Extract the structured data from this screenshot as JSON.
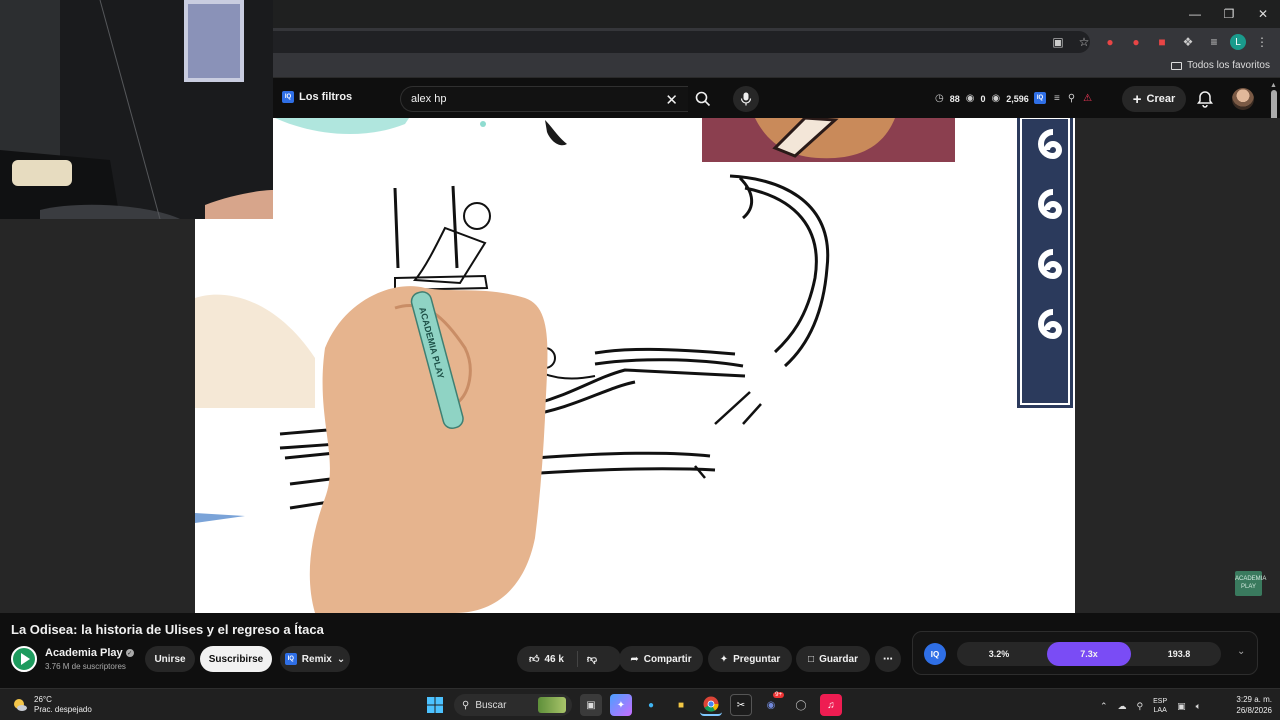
{
  "browser": {
    "bookmarks_folder": "Todos los favoritos",
    "profile_initial": "L"
  },
  "header": {
    "filters_label": "Los filtros",
    "iq_label": "IQ",
    "search_value": "alex hp",
    "stats": {
      "time": "88",
      "views_zero": "0",
      "views": "2,596"
    },
    "create_label": "Crear"
  },
  "video": {
    "title": "La Odisea: la historia de Ulises y el regreso a Ítaca",
    "watermark": "ACADEMIA PLAY",
    "pen_text": "ACADEMIA PLAY"
  },
  "channel": {
    "name": "Academia Play",
    "subscribers": "3.76 M de suscriptores",
    "join_label": "Unirse",
    "subscribe_label": "Suscribirse",
    "remix_label": "Remix"
  },
  "actions": {
    "likes": "46 k",
    "share_label": "Compartir",
    "ask_label": "Preguntar",
    "save_label": "Guardar"
  },
  "speed": {
    "values": [
      "3.2%",
      "7.3x",
      "193.8"
    ],
    "active_index": 1
  },
  "taskbar": {
    "temperature": "26°C",
    "weather_desc": "Prac. despejado",
    "search_label": "Buscar",
    "lang_top": "ESP",
    "lang_bottom": "LAA",
    "time": "3:29 a. m.",
    "date": "26/8/2026",
    "notif_badge": "9+"
  },
  "colors": {
    "accent_speed": "#7a4cf5",
    "iq_blue": "#2f6fe6",
    "channel_green": "#1e9b5e"
  }
}
